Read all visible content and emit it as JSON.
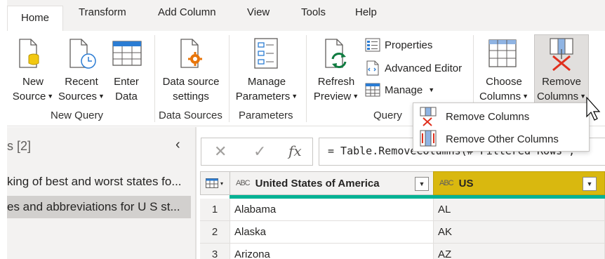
{
  "tabs": [
    "Home",
    "Transform",
    "Add Column",
    "View",
    "Tools",
    "Help"
  ],
  "ribbon": {
    "new_source": [
      "New",
      "Source"
    ],
    "recent_sources": [
      "Recent",
      "Sources"
    ],
    "enter_data": [
      "Enter",
      "Data"
    ],
    "group_new_query": "New Query",
    "data_source_settings": [
      "Data source",
      "settings"
    ],
    "group_data_sources": "Data Sources",
    "manage_parameters": [
      "Manage",
      "Parameters"
    ],
    "group_parameters": "Parameters",
    "refresh_preview": [
      "Refresh",
      "Preview"
    ],
    "properties": "Properties",
    "advanced_editor": "Advanced Editor",
    "manage": "Manage",
    "group_query": "Query",
    "choose_columns": [
      "Choose",
      "Columns"
    ],
    "remove_columns": [
      "Remove",
      "Columns"
    ]
  },
  "dropdown": {
    "items": [
      "Remove Columns",
      "Remove Other Columns"
    ]
  },
  "left_panel": {
    "title": "s [2]",
    "items": [
      "king of best and worst states fo...",
      "es and abbreviations for U S st..."
    ]
  },
  "formula_bar": {
    "cancel": "✕",
    "commit": "✓",
    "fx": "fx",
    "formula": "= Table.RemoveColumns(#\"Filtered Rows\","
  },
  "grid": {
    "type_label": "ABC",
    "columns": [
      "United States of America",
      "US"
    ],
    "rows": [
      {
        "num": "1",
        "values": [
          "Alabama",
          "AL"
        ]
      },
      {
        "num": "2",
        "values": [
          "Alaska",
          "AK"
        ]
      },
      {
        "num": "3",
        "values": [
          "Arizona",
          "AZ"
        ]
      }
    ]
  },
  "colors": {
    "accent_selected_column": "#d9b80f",
    "quality_bar": "#00b294",
    "remove_red": "#e0301e"
  }
}
